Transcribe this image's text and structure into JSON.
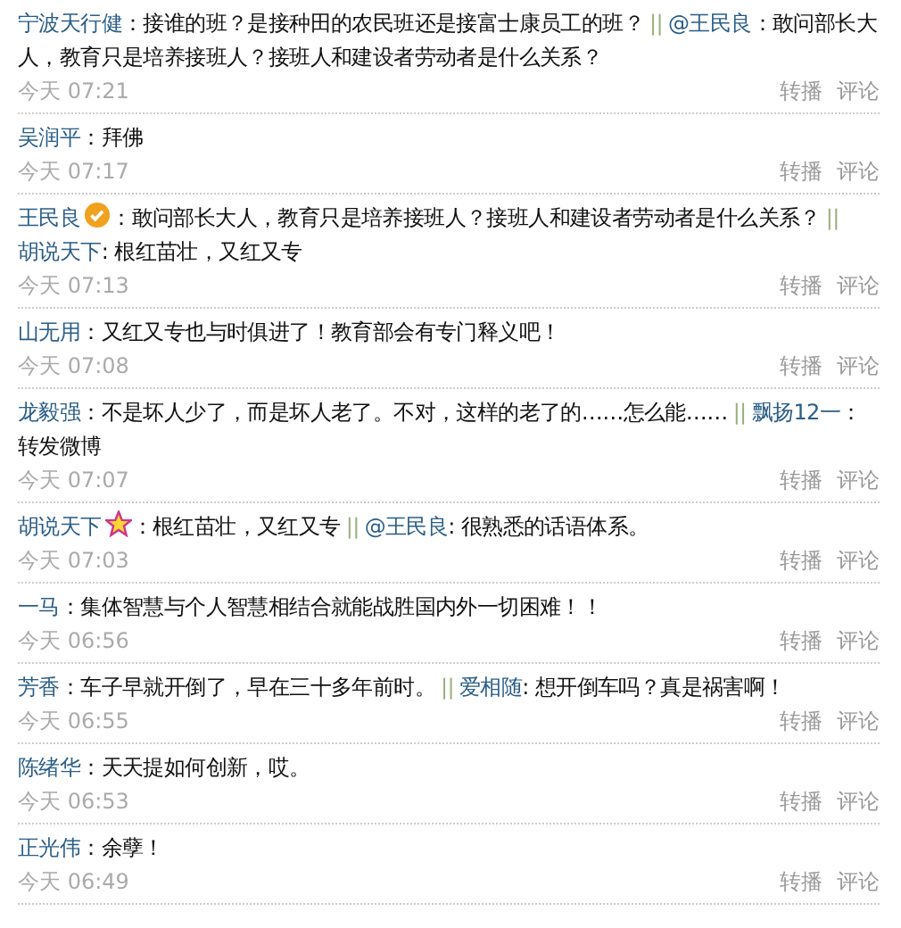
{
  "posts": [
    {
      "author": "宁波天行健",
      "text": "：接谁的班？是接种田的农民班还是接富士康员工的班？",
      "repost": {
        "sep": "||",
        "author": "@王民良",
        "text": "：敢问部长大人，教育只是培养接班人？接班人和建设者劳动者是什么关系？"
      },
      "time": "今天 07:21",
      "actions": [
        "转播",
        "评论"
      ]
    },
    {
      "author": "吴润平",
      "text": "：拜佛",
      "time": "今天 07:17",
      "actions": [
        "转播",
        "评论"
      ]
    },
    {
      "author": "王民良",
      "badge": {
        "kind": "verified"
      },
      "text": "：敢问部长大人，教育只是培养接班人？接班人和建设者劳动者是什么关系？",
      "repost": {
        "sep": "||",
        "author": "胡说天下",
        "text": ": 根红苗壮，又红又专"
      },
      "time": "今天 07:13",
      "actions": [
        "转播",
        "评论"
      ]
    },
    {
      "author": "山无用",
      "text": "：又红又专也与时俱进了！教育部会有专门释义吧！",
      "time": "今天 07:08",
      "actions": [
        "转播",
        "评论"
      ]
    },
    {
      "author": "龙毅强",
      "text": "：不是坏人少了，而是坏人老了。不对，这样的老了的……怎么能……",
      "repost": {
        "sep": "||",
        "author": "飘扬12一",
        "text": "：转发微博"
      },
      "time": "今天 07:07",
      "actions": [
        "转播",
        "评论"
      ]
    },
    {
      "author": "胡说天下",
      "badge": {
        "kind": "star"
      },
      "text": "：根红苗壮，又红又专",
      "repost": {
        "sep": "||",
        "author": "@王民良",
        "text": ": 很熟悉的话语体系。"
      },
      "time": "今天 07:03",
      "actions": [
        "转播",
        "评论"
      ]
    },
    {
      "author": "一马",
      "text": "：集体智慧与个人智慧相结合就能战胜国内外一切困难！！",
      "time": "今天 06:56",
      "actions": [
        "转播",
        "评论"
      ]
    },
    {
      "author": "芳香",
      "text": "：车子早就开倒了，早在三十多年前时。",
      "repost": {
        "sep": "||",
        "author": "爱相随",
        "text": ": 想开倒车吗？真是祸害啊！"
      },
      "time": "今天 06:55",
      "actions": [
        "转播",
        "评论"
      ]
    },
    {
      "author": "陈绪华",
      "text": "：天天提如何创新，哎。",
      "time": "今天 06:53",
      "actions": [
        "转播",
        "评论"
      ]
    },
    {
      "author": "正光伟",
      "text": "：余孽！",
      "time": "今天 06:49",
      "actions": [
        "转播",
        "评论"
      ]
    }
  ]
}
